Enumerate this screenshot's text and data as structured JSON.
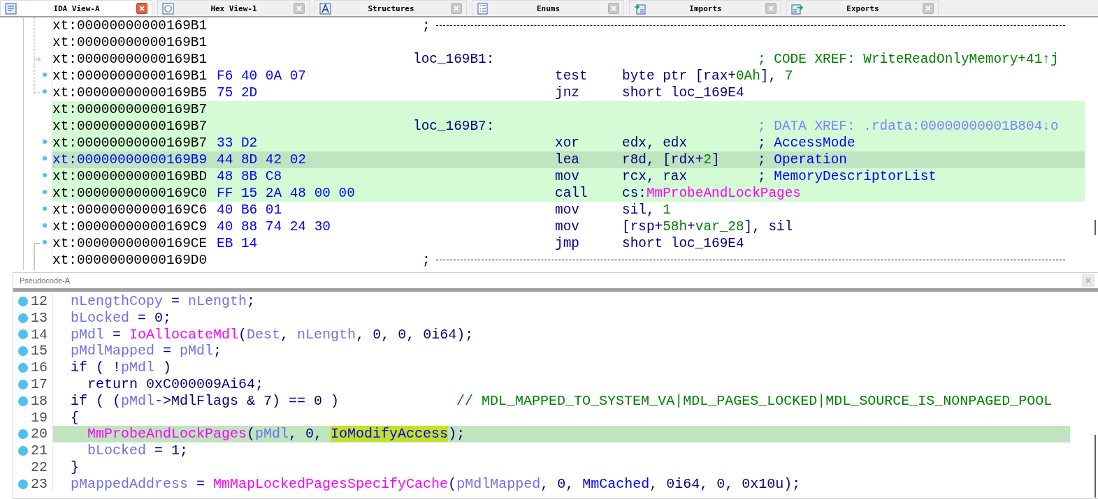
{
  "tabs": [
    {
      "kind": "disassembly",
      "label": "IDA View-A",
      "selected": true
    },
    {
      "kind": "hex",
      "label": "Hex View-1",
      "selected": false
    },
    {
      "kind": "structures",
      "label": "Structures",
      "selected": false
    },
    {
      "kind": "enums",
      "label": "Enums",
      "selected": false
    },
    {
      "kind": "imports",
      "label": "Imports",
      "selected": false
    },
    {
      "kind": "exports",
      "label": "Exports",
      "selected": false
    }
  ],
  "disassembly": {
    "rows": [
      {
        "kind": "separator",
        "address": "xt:00000000000169B1",
        "highlighted": false,
        "current": false,
        "dot": false,
        "text": ";"
      },
      {
        "kind": "code",
        "address": "xt:00000000000169B1",
        "highlighted": false,
        "current": false,
        "dot": false
      },
      {
        "kind": "code",
        "address": "xt:00000000000169B1",
        "highlighted": false,
        "current": false,
        "dot": false,
        "label": "loc_169B1:",
        "comment": [
          {
            "kind": "xref",
            "text": "; CODE XREF: WriteReadOnlyMemory+41↑j"
          }
        ]
      },
      {
        "kind": "code",
        "address": "xt:00000000000169B1",
        "bytes": "F6 40 0A 07",
        "highlighted": false,
        "current": false,
        "dot": true,
        "mnemonic": "test",
        "operands": [
          {
            "kind": "plain",
            "text": "byte ptr [rax+"
          },
          {
            "kind": "num",
            "text": "0Ah"
          },
          {
            "kind": "plain",
            "text": "], "
          },
          {
            "kind": "num",
            "text": "7"
          }
        ]
      },
      {
        "kind": "code",
        "address": "xt:00000000000169B5",
        "bytes": "75 2D",
        "highlighted": false,
        "current": false,
        "dot": true,
        "mnemonic": "jnz",
        "operands": [
          {
            "kind": "plain",
            "text": "short loc_169E4"
          }
        ]
      },
      {
        "kind": "code",
        "address": "xt:00000000000169B7",
        "highlighted": true,
        "current": false,
        "dot": false
      },
      {
        "kind": "code",
        "address": "xt:00000000000169B7",
        "highlighted": true,
        "current": false,
        "dot": false,
        "label": "loc_169B7:",
        "comment": [
          {
            "kind": "dataxref",
            "text": "; DATA XREF: .rdata:00000000001B804↓o"
          }
        ]
      },
      {
        "kind": "code",
        "address": "xt:00000000000169B7",
        "bytes": "33 D2",
        "highlighted": true,
        "current": false,
        "dot": true,
        "mnemonic": "xor",
        "operands": [
          {
            "kind": "plain",
            "text": "edx, edx"
          }
        ],
        "comment": [
          {
            "kind": "plain",
            "text": "; "
          },
          {
            "kind": "name",
            "text": "AccessMode"
          }
        ]
      },
      {
        "kind": "code",
        "address": "xt:00000000000169B9",
        "bytes": "44 8D 42 02",
        "highlighted": true,
        "current": true,
        "dot": true,
        "mnemonic": "lea",
        "operands": [
          {
            "kind": "plain",
            "text": "r8d, [rdx+"
          },
          {
            "kind": "num",
            "text": "2"
          },
          {
            "kind": "plain",
            "text": "]"
          }
        ],
        "comment": [
          {
            "kind": "plain",
            "text": "; "
          },
          {
            "kind": "name",
            "text": "Operation"
          }
        ]
      },
      {
        "kind": "code",
        "address": "xt:00000000000169BD",
        "bytes": "48 8B C8",
        "highlighted": true,
        "current": false,
        "dot": true,
        "mnemonic": "mov",
        "operands": [
          {
            "kind": "plain",
            "text": "rcx, rax"
          }
        ],
        "comment": [
          {
            "kind": "plain",
            "text": "; "
          },
          {
            "kind": "name",
            "text": "MemoryDescriptorList"
          }
        ]
      },
      {
        "kind": "code",
        "address": "xt:00000000000169C0",
        "bytes": "FF 15 2A 48 00 00",
        "highlighted": true,
        "current": false,
        "dot": true,
        "mnemonic": "call",
        "operands": [
          {
            "kind": "plain",
            "text": "cs:"
          },
          {
            "kind": "func",
            "text": "MmProbeAndLockPages"
          }
        ]
      },
      {
        "kind": "code",
        "address": "xt:00000000000169C6",
        "bytes": "40 B6 01",
        "highlighted": false,
        "current": false,
        "dot": true,
        "mnemonic": "mov",
        "operands": [
          {
            "kind": "plain",
            "text": "sil, "
          },
          {
            "kind": "num",
            "text": "1"
          }
        ]
      },
      {
        "kind": "code",
        "address": "xt:00000000000169C9",
        "bytes": "40 88 74 24 30",
        "highlighted": false,
        "current": false,
        "dot": true,
        "mnemonic": "mov",
        "operands": [
          {
            "kind": "plain",
            "text": "[rsp+"
          },
          {
            "kind": "num",
            "text": "58h"
          },
          {
            "kind": "plain",
            "text": "+"
          },
          {
            "kind": "num",
            "text": "var_28"
          },
          {
            "kind": "plain",
            "text": "], sil"
          }
        ]
      },
      {
        "kind": "code",
        "address": "xt:00000000000169CE",
        "bytes": "EB 14",
        "highlighted": false,
        "current": false,
        "dot": true,
        "mnemonic": "jmp",
        "operands": [
          {
            "kind": "plain",
            "text": "short loc_169E4"
          }
        ]
      },
      {
        "kind": "separator",
        "address": "xt:00000000000169D0",
        "highlighted": false,
        "current": false,
        "dot": false,
        "text": ";"
      }
    ]
  },
  "pseudocode": {
    "title": "Pseudocode-A",
    "lines": [
      {
        "number": "12",
        "dot": true,
        "current": false,
        "indented": false,
        "tokens": [
          {
            "kind": "var",
            "text": "nLengthCopy"
          },
          {
            "kind": "plain",
            "text": " = "
          },
          {
            "kind": "var",
            "text": "nLength"
          },
          {
            "kind": "plain",
            "text": ";"
          }
        ]
      },
      {
        "number": "13",
        "dot": true,
        "current": false,
        "indented": false,
        "tokens": [
          {
            "kind": "var",
            "text": "bLocked"
          },
          {
            "kind": "plain",
            "text": " = 0;"
          }
        ]
      },
      {
        "number": "14",
        "dot": true,
        "current": false,
        "indented": false,
        "tokens": [
          {
            "kind": "var",
            "text": "pMdl"
          },
          {
            "kind": "plain",
            "text": " = "
          },
          {
            "kind": "func",
            "text": "IoAllocateMdl"
          },
          {
            "kind": "plain",
            "text": "("
          },
          {
            "kind": "var",
            "text": "Dest"
          },
          {
            "kind": "plain",
            "text": ", "
          },
          {
            "kind": "var",
            "text": "nLength"
          },
          {
            "kind": "plain",
            "text": ", 0, 0, 0i64);"
          }
        ]
      },
      {
        "number": "15",
        "dot": true,
        "current": false,
        "indented": false,
        "tokens": [
          {
            "kind": "var",
            "text": "pMdlMapped"
          },
          {
            "kind": "plain",
            "text": " = "
          },
          {
            "kind": "var",
            "text": "pMdl"
          },
          {
            "kind": "plain",
            "text": ";"
          }
        ]
      },
      {
        "number": "16",
        "dot": true,
        "current": false,
        "indented": false,
        "tokens": [
          {
            "kind": "plain",
            "text": "if ( !"
          },
          {
            "kind": "var",
            "text": "pMdl"
          },
          {
            "kind": "plain",
            "text": " )"
          }
        ]
      },
      {
        "number": "17",
        "dot": true,
        "current": false,
        "indented": true,
        "tokens": [
          {
            "kind": "plain",
            "text": "return 0xC000009Ai64;"
          }
        ]
      },
      {
        "number": "18",
        "dot": true,
        "current": false,
        "indented": false,
        "tokens": [
          {
            "kind": "plain",
            "text": "if ( ("
          },
          {
            "kind": "var",
            "text": "pMdl"
          },
          {
            "kind": "plain",
            "text": "->MdlFlags & 7) == 0 )"
          }
        ],
        "comment": "// MDL_MAPPED_TO_SYSTEM_VA|MDL_PAGES_LOCKED|MDL_SOURCE_IS_NONPAGED_POOL"
      },
      {
        "number": "19",
        "dot": false,
        "current": false,
        "indented": false,
        "tokens": [
          {
            "kind": "plain",
            "text": "{"
          }
        ]
      },
      {
        "number": "20",
        "dot": true,
        "current": true,
        "indented": true,
        "tokens": [
          {
            "kind": "func",
            "text": "MmProbeAndLockPages"
          },
          {
            "kind": "plain",
            "text": "("
          },
          {
            "kind": "var",
            "text": "pMdl"
          },
          {
            "kind": "plain",
            "text": ", 0, "
          },
          {
            "kind": "match",
            "text": "IoModifyAccess"
          },
          {
            "kind": "plain",
            "text": ");"
          }
        ]
      },
      {
        "number": "21",
        "dot": true,
        "current": false,
        "indented": true,
        "tokens": [
          {
            "kind": "var",
            "text": "bLocked"
          },
          {
            "kind": "plain",
            "text": " = 1;"
          }
        ]
      },
      {
        "number": "22",
        "dot": false,
        "current": false,
        "indented": false,
        "tokens": [
          {
            "kind": "plain",
            "text": "}"
          }
        ]
      },
      {
        "number": "23",
        "dot": true,
        "current": false,
        "indented": false,
        "tokens": [
          {
            "kind": "var",
            "text": "pMappedAddress"
          },
          {
            "kind": "plain",
            "text": " = "
          },
          {
            "kind": "func",
            "text": "MmMapLockedPagesSpecifyCache"
          },
          {
            "kind": "plain",
            "text": "("
          },
          {
            "kind": "var",
            "text": "pMdlMapped"
          },
          {
            "kind": "plain",
            "text": ", 0, "
          },
          {
            "kind": "const",
            "text": "MmCached"
          },
          {
            "kind": "plain",
            "text": ", 0i64, 0, 0x10u);"
          }
        ]
      }
    ]
  }
}
